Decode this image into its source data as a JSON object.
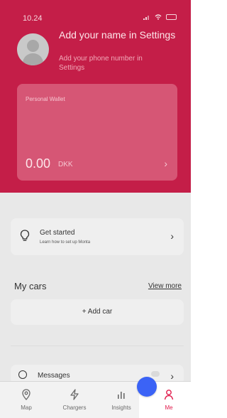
{
  "status": {
    "time": "10.24"
  },
  "profile": {
    "name": "Add your name in Settings",
    "phone": "Add your phone number in Settings"
  },
  "wallet": {
    "title": "Personal Wallet",
    "amount": "0.00",
    "currency": "DKK"
  },
  "get_started": {
    "title": "Get started",
    "subtitle": "Learn how to set up Monta"
  },
  "cars": {
    "title": "My cars",
    "view_more": "View more",
    "add_label": "+ Add car"
  },
  "messages": {
    "label": "Messages"
  },
  "nav": {
    "items": [
      {
        "label": "Map",
        "icon": "map-pin-icon"
      },
      {
        "label": "Chargers",
        "icon": "lightning-icon"
      },
      {
        "label": "Insights",
        "icon": "bar-chart-icon"
      },
      {
        "label": "Me",
        "icon": "person-icon"
      }
    ],
    "active": "Me"
  },
  "colors": {
    "header": "#c41e48",
    "active": "#e11a4b",
    "fab": "#3b63f6"
  }
}
